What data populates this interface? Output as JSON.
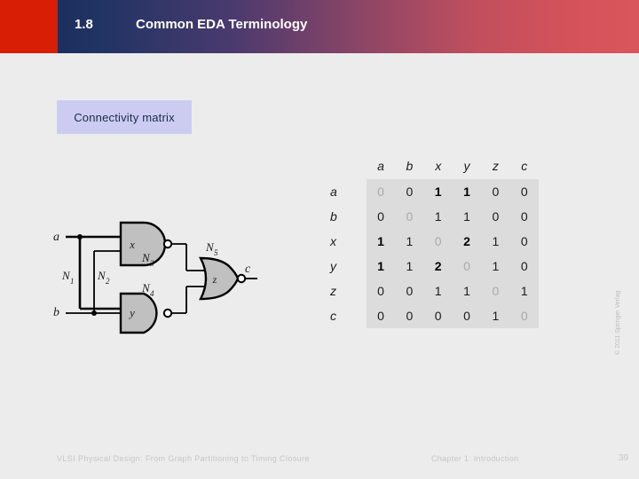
{
  "header": {
    "slide_number": "1.8",
    "title": "Common EDA Terminology",
    "red_block_color": "#d81e05",
    "gradient_start_color": "#1b2f5e",
    "gradient_end_color": "#d9565c",
    "title_color": "#ffffff"
  },
  "callout": {
    "label": "Connectivity matrix",
    "background_color": "#ccccf2",
    "text_color": "#1f2a44"
  },
  "circuit": {
    "inputs": [
      {
        "name": "a",
        "label": "a"
      },
      {
        "name": "b",
        "label": "b"
      }
    ],
    "output": {
      "name": "c",
      "label": "c"
    },
    "gates": [
      {
        "id": "x",
        "label": "x",
        "type": "nand"
      },
      {
        "id": "y",
        "label": "y",
        "type": "nand"
      },
      {
        "id": "z",
        "label": "z",
        "type": "nor"
      }
    ],
    "nets": [
      {
        "id": "N1",
        "label": "N",
        "subscript": "1"
      },
      {
        "id": "N2",
        "label": "N",
        "subscript": "2"
      },
      {
        "id": "N3",
        "label": "N",
        "subscript": "3"
      },
      {
        "id": "N4",
        "label": "N",
        "subscript": "4"
      },
      {
        "id": "N5",
        "label": "N",
        "subscript": "5"
      }
    ],
    "gate_fill_color": "#c0c0c0",
    "wire_color": "#000000"
  },
  "matrix": {
    "column_headers": [
      "a",
      "b",
      "x",
      "y",
      "z",
      "c"
    ],
    "row_headers": [
      "a",
      "b",
      "x",
      "y",
      "z",
      "c"
    ],
    "cell_background_color": "#dcdcdc",
    "diagonal_text_color": "#a9a9a9",
    "rows": [
      {
        "label": "a",
        "values": [
          "0",
          "0",
          "1",
          "1",
          "0",
          "0"
        ],
        "emphasis": [
          false,
          false,
          true,
          true,
          false,
          false
        ]
      },
      {
        "label": "b",
        "values": [
          "0",
          "0",
          "1",
          "1",
          "0",
          "0"
        ],
        "emphasis": [
          false,
          false,
          false,
          false,
          false,
          false
        ]
      },
      {
        "label": "x",
        "values": [
          "1",
          "1",
          "0",
          "2",
          "1",
          "0"
        ],
        "emphasis": [
          true,
          false,
          false,
          true,
          false,
          false
        ]
      },
      {
        "label": "y",
        "values": [
          "1",
          "1",
          "2",
          "0",
          "1",
          "0"
        ],
        "emphasis": [
          true,
          false,
          true,
          false,
          false,
          false
        ]
      },
      {
        "label": "z",
        "values": [
          "0",
          "0",
          "1",
          "1",
          "0",
          "1"
        ],
        "emphasis": [
          false,
          false,
          false,
          false,
          false,
          false
        ]
      },
      {
        "label": "c",
        "values": [
          "0",
          "0",
          "0",
          "0",
          "1",
          "0"
        ],
        "emphasis": [
          false,
          false,
          false,
          false,
          false,
          false
        ]
      }
    ]
  },
  "chart_data": {
    "type": "table",
    "title": "Connectivity matrix",
    "categories": [
      "a",
      "b",
      "x",
      "y",
      "z",
      "c"
    ],
    "series": [
      {
        "name": "a",
        "values": [
          0,
          0,
          1,
          1,
          0,
          0
        ]
      },
      {
        "name": "b",
        "values": [
          0,
          0,
          1,
          1,
          0,
          0
        ]
      },
      {
        "name": "x",
        "values": [
          1,
          1,
          0,
          2,
          1,
          0
        ]
      },
      {
        "name": "y",
        "values": [
          1,
          1,
          2,
          0,
          1,
          0
        ]
      },
      {
        "name": "z",
        "values": [
          0,
          0,
          1,
          1,
          0,
          1
        ]
      },
      {
        "name": "c",
        "values": [
          0,
          0,
          0,
          0,
          1,
          0
        ]
      }
    ]
  },
  "footer": {
    "book_title": "VLSI Physical Design: From Graph Partitioning to Timing Closure",
    "chapter": "Chapter 1: Introduction",
    "page_number": "39",
    "copyright": "© 2011 Springer Verlag"
  }
}
